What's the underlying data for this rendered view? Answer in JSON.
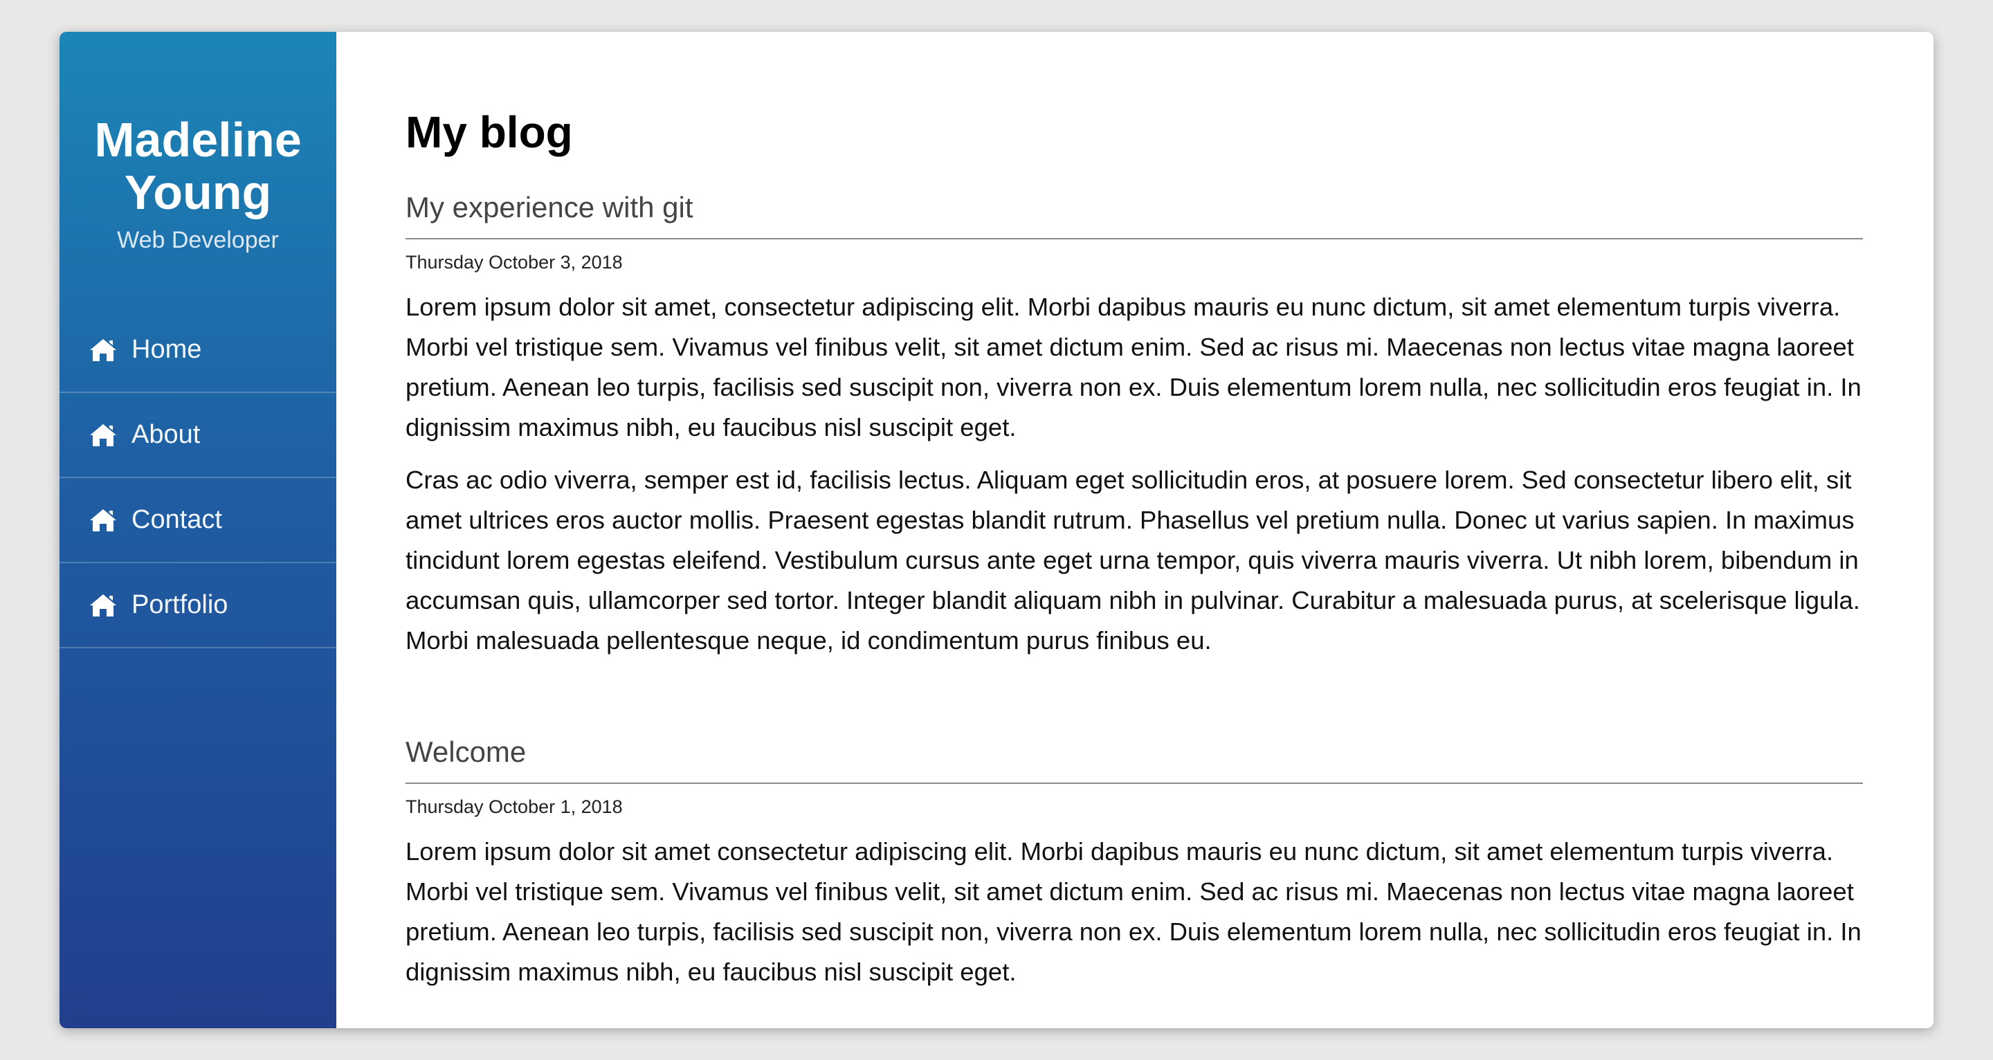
{
  "sidebar": {
    "name_line1": "Madeline",
    "name_line2": "Young",
    "role": "Web Developer",
    "items": [
      {
        "label": "Home",
        "icon": "home-icon"
      },
      {
        "label": "About",
        "icon": "home-icon"
      },
      {
        "label": "Contact",
        "icon": "home-icon"
      },
      {
        "label": "Portfolio",
        "icon": "home-icon"
      }
    ]
  },
  "main": {
    "title": "My blog",
    "posts": [
      {
        "title": "My experience with git",
        "date": "Thursday October 3, 2018",
        "paragraphs": [
          "Lorem ipsum dolor sit amet, consectetur adipiscing elit. Morbi dapibus mauris eu nunc dictum, sit amet elementum turpis viverra. Morbi vel tristique sem. Vivamus vel finibus velit, sit amet dictum enim. Sed ac risus mi. Maecenas non lectus vitae magna laoreet pretium. Aenean leo turpis, facilisis sed suscipit non, viverra non ex. Duis elementum lorem nulla, nec sollicitudin eros feugiat in. In dignissim maximus nibh, eu faucibus nisl suscipit eget.",
          "Cras ac odio viverra, semper est id, facilisis lectus. Aliquam eget sollicitudin eros, at posuere lorem. Sed consectetur libero elit, sit amet ultrices eros auctor mollis. Praesent egestas blandit rutrum. Phasellus vel pretium nulla. Donec ut varius sapien. In maximus tincidunt lorem egestas eleifend. Vestibulum cursus ante eget urna tempor, quis viverra mauris viverra. Ut nibh lorem, bibendum in accumsan quis, ullamcorper sed tortor. Integer blandit aliquam nibh in pulvinar. Curabitur a malesuada purus, at scelerisque ligula. Morbi malesuada pellentesque neque, id condimentum purus finibus eu."
        ]
      },
      {
        "title": "Welcome",
        "date": "Thursday October 1, 2018",
        "paragraphs": [
          "Lorem ipsum dolor sit amet consectetur adipiscing elit. Morbi dapibus mauris eu nunc dictum, sit amet elementum turpis viverra. Morbi vel tristique sem. Vivamus vel finibus velit, sit amet dictum enim. Sed ac risus mi. Maecenas non lectus vitae magna laoreet pretium. Aenean leo turpis, facilisis sed suscipit non, viverra non ex. Duis elementum lorem nulla, nec sollicitudin eros feugiat in. In dignissim maximus nibh, eu faucibus nisl suscipit eget."
        ]
      }
    ]
  }
}
